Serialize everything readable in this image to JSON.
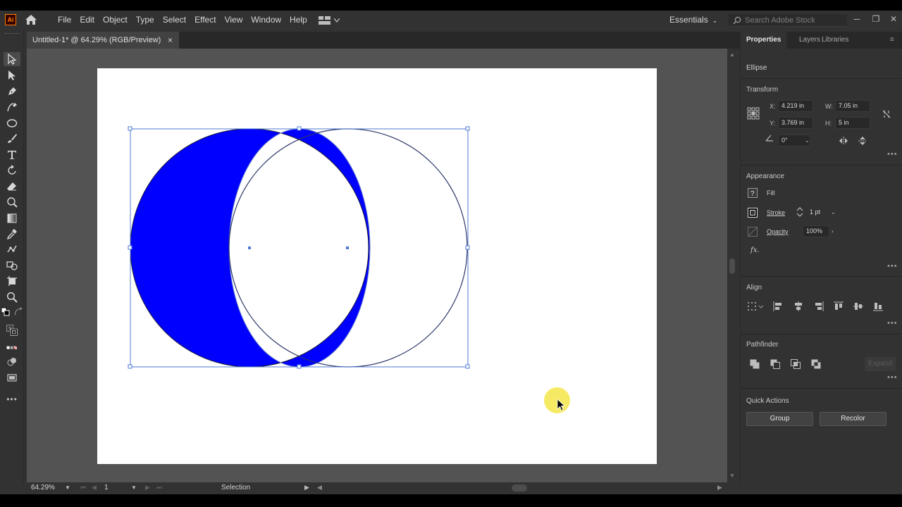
{
  "app": {
    "logo_text": "Ai",
    "accent_color": "#ff7c00"
  },
  "menu": {
    "items": [
      "File",
      "Edit",
      "Object",
      "Type",
      "Select",
      "Effect",
      "View",
      "Window",
      "Help"
    ]
  },
  "workspace": {
    "label": "Essentials"
  },
  "search": {
    "placeholder": "Search Adobe Stock"
  },
  "window_controls": {
    "minimize": "─",
    "restore": "❐",
    "close": "✕"
  },
  "document_tab": {
    "title": "Untitled-1* @ 64.29% (RGB/Preview)",
    "close_glyph": "×"
  },
  "canvas": {
    "fill_color": "#0000ff",
    "selection_color": "#4f7ad1"
  },
  "statusbar": {
    "zoom": "64.29%",
    "page": "1",
    "status": "Selection"
  },
  "panel": {
    "tabs": [
      "Properties",
      "Layers",
      "Libraries"
    ],
    "object_type": "Ellipse",
    "transform": {
      "title": "Transform",
      "x_label": "X:",
      "x": "4.219 in",
      "y_label": "Y:",
      "y": "3.769 in",
      "w_label": "W:",
      "w": "7.05 in",
      "h_label": "H:",
      "h": "5 in",
      "angle": "0°"
    },
    "appearance": {
      "title": "Appearance",
      "fill_label": "Fill",
      "stroke_label": "Stroke",
      "stroke_value": "1 pt",
      "opacity_label": "Opacity",
      "opacity_value": "100%",
      "fx_label": "fx."
    },
    "align": {
      "title": "Align"
    },
    "pathfinder": {
      "title": "Pathfinder",
      "expand_label": "Expand"
    },
    "quick_actions": {
      "title": "Quick Actions",
      "group_label": "Group",
      "recolor_label": "Recolor"
    }
  }
}
